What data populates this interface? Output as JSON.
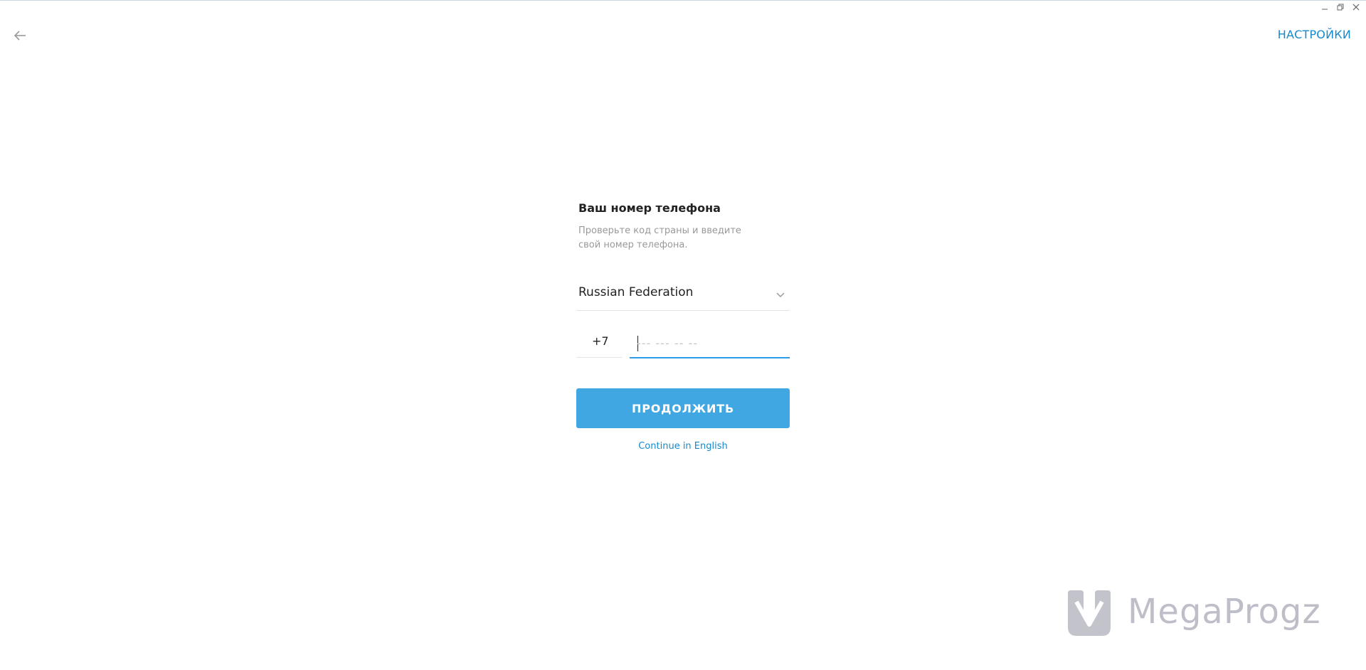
{
  "window": {
    "minimize_icon": "minimize-icon",
    "restore_icon": "restore-icon",
    "close_icon": "close-icon"
  },
  "header": {
    "back_icon": "arrow-left-icon",
    "settings_label": "НАСТРОЙКИ"
  },
  "login": {
    "title": "Ваш номер телефона",
    "description_line1": "Проверьте код страны и введите",
    "description_line2": "свой номер телефона.",
    "country": {
      "selected": "Russian Federation",
      "icon": "chevron-down-icon"
    },
    "phone": {
      "code": "+7",
      "value": "",
      "placeholder": "--- --- -- --"
    },
    "continue_label": "ПРОДОЛЖИТЬ",
    "english_link": "Continue in English"
  },
  "watermark": {
    "text": "MegaProgz"
  },
  "colors": {
    "accent": "#40a7e3",
    "link": "#168acd",
    "input_focus": "#2a9be6"
  }
}
